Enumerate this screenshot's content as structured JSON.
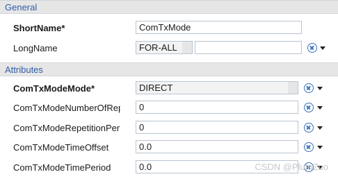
{
  "general": {
    "title": "General",
    "short_name": {
      "label": "ShortName*",
      "value": "ComTxMode"
    },
    "long_name": {
      "label": "LongName",
      "language": "FOR-ALL",
      "value": ""
    }
  },
  "attributes": {
    "title": "Attributes",
    "rows": [
      {
        "label": "ComTxModeMode*",
        "value": "DIRECT"
      },
      {
        "label": "ComTxModeNumberOfRepetitions",
        "value": "0"
      },
      {
        "label": "ComTxModeRepetitionPeriod",
        "value": "0"
      },
      {
        "label": "ComTxModeTimeOffset",
        "value": "0.0"
      },
      {
        "label": "ComTxModeTimePeriod",
        "value": "0.0"
      }
    ]
  },
  "icons": {
    "reset": "reset-icon",
    "dropdown": "chevron-down-icon"
  },
  "watermark": "CSDN @PlutoZuo",
  "colors": {
    "section_title": "#2f5ca8",
    "section_bg": "#e6e6e6",
    "icon": "#3b6fb6"
  }
}
